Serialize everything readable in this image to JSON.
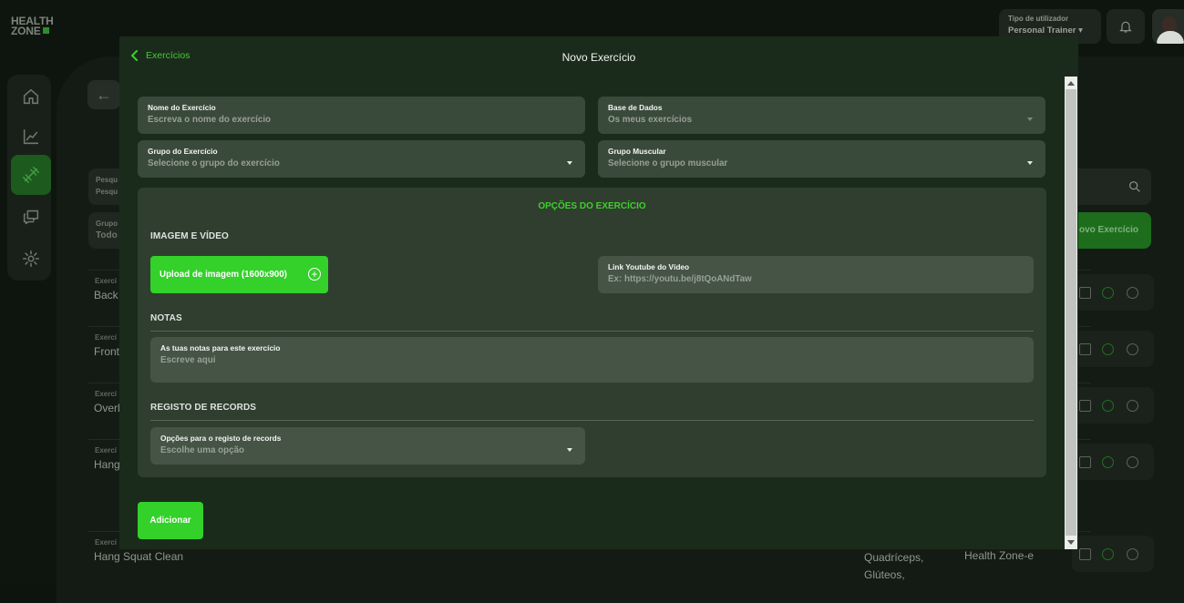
{
  "background": {
    "logo": {
      "line1": "HEALTH",
      "line2": "ZONE"
    },
    "user_type": {
      "label": "Tipo de utilizador",
      "value": "Personal Trainer"
    },
    "filters": [
      {
        "label": "Pesqu",
        "value": "Pesqu"
      },
      {
        "label": "Grupo",
        "value": "Todo"
      }
    ],
    "new_exercise_button": "ovo Exercício",
    "rows": [
      {
        "label": "Exercí",
        "name": "Back"
      },
      {
        "label": "Exercí",
        "name": "Front"
      },
      {
        "label": "Exercí",
        "name": "Overl"
      },
      {
        "label": "Exercí",
        "name": "Hang"
      },
      {
        "label": "Exercí",
        "name": "Hang Squat Clean"
      }
    ],
    "last_row_categories": [
      "Quadríceps,",
      "Glúteos,"
    ],
    "last_row_source": "Health Zone-e"
  },
  "modal": {
    "back_label": "Exercícios",
    "title": "Novo Exercício",
    "fields": {
      "name": {
        "label": "Nome do Exercício",
        "placeholder": "Escreva o nome do exercício"
      },
      "database": {
        "label": "Base de Dados",
        "value": "Os meus exercícios"
      },
      "group": {
        "label": "Grupo do Exercício",
        "value": "Selecione o grupo do exercício"
      },
      "muscle_group": {
        "label": "Grupo Muscular",
        "value": "Selecione o grupo muscular"
      }
    },
    "options": {
      "title": "OPÇÕES DO EXERCÍCIO",
      "image_video": {
        "heading": "IMAGEM E VÍDEO",
        "upload_label": "Upload de imagem (1600x900)",
        "youtube": {
          "label": "Link Youtube do Vídeo",
          "placeholder": "Ex: https://youtu.be/j8tQoANdTaw"
        }
      },
      "notes": {
        "heading": "NOTAS",
        "label": "As tuas notas para este exercício",
        "placeholder": "Escreve aqui"
      },
      "records": {
        "heading": "REGISTO DE RECORDS",
        "label": "Opções para o registo de records",
        "value": "Escolhe uma opção"
      }
    },
    "submit_label": "Adicionar"
  },
  "colors": {
    "accent": "#33d12a",
    "modal_bg": "#1b2b1b",
    "field_bg": "#3a4a3a",
    "panel_bg": "#2f3e2f"
  }
}
